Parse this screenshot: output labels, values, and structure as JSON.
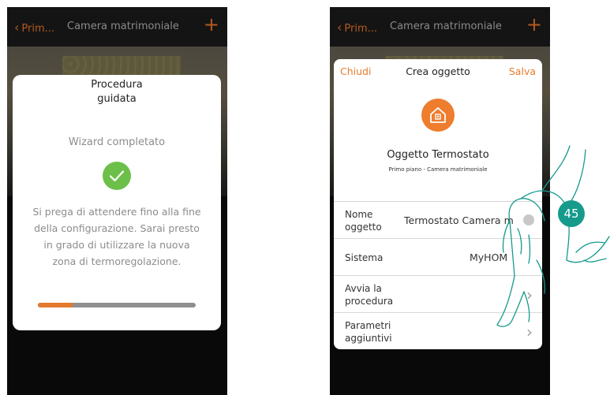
{
  "left_screen": {
    "back_label": "Prim...",
    "title": "Camera matrimoniale",
    "add_label": "+",
    "dialog": {
      "title": "Procedura guidata",
      "status": "Wizard completato",
      "message": "Si prega di attendere fino alla fine della configurazione. Sarai presto in grado di utilizzare la nuova zona di termoregolazione.",
      "progress_percent": 22
    }
  },
  "right_screen": {
    "back_label": "Prim...",
    "title": "Camera matrimoniale",
    "add_label": "+",
    "dialog": {
      "close_label": "Chiudi",
      "title": "Crea oggetto",
      "save_label": "Salva",
      "object_name": "Oggetto Termostato",
      "object_location": "Primo piano - Camera matrimoniale",
      "rows": [
        {
          "label": "Nome oggetto",
          "value": "Termostato Camera m"
        },
        {
          "label": "Sistema",
          "value": "MyHOM"
        },
        {
          "label": "Avvia la procedura",
          "value": ""
        },
        {
          "label": "Parametri aggiuntivi",
          "value": ""
        }
      ]
    }
  },
  "step_badge": "45",
  "colors": {
    "accent": "#e57b2c",
    "check": "#6cc04a",
    "badge": "#169a8c"
  }
}
